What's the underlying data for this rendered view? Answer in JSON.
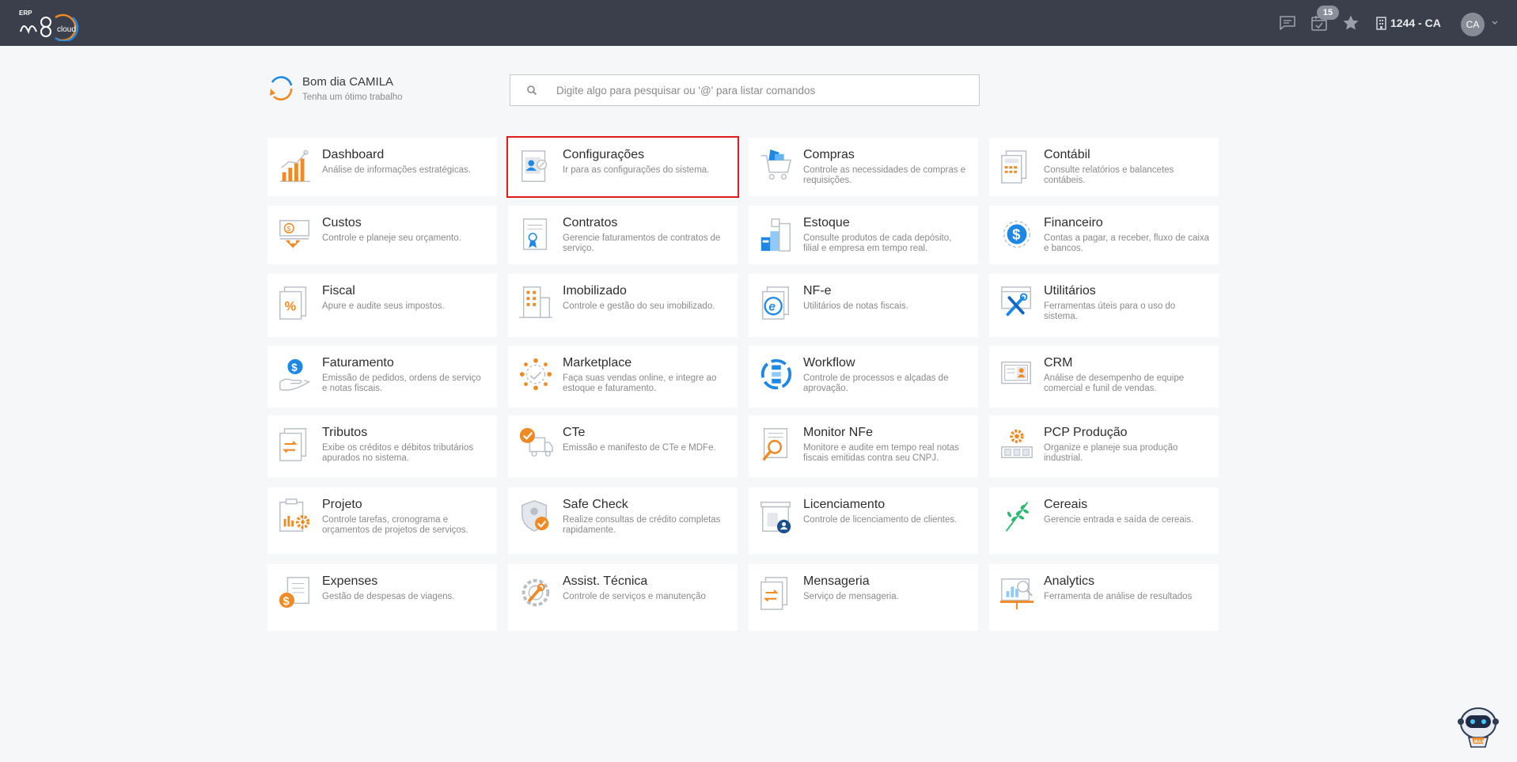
{
  "header": {
    "logo_erp": "ERP",
    "logo_m": "m8",
    "logo_cloud": "cloud",
    "notifications_badge": "15",
    "company": "1244 - CA",
    "avatar": "CA",
    "icons": [
      "chat-icon",
      "calendar-check-icon",
      "star-icon",
      "building-icon",
      "chevron-down-icon"
    ]
  },
  "greeting": {
    "title": "Bom dia CAMILA",
    "subtitle": "Tenha um ótimo trabalho"
  },
  "search": {
    "placeholder": "Digite algo para pesquisar ou '@' para listar comandos"
  },
  "modules": [
    {
      "title": "Dashboard",
      "desc": "Análise de informações estratégicas."
    },
    {
      "title": "Configurações",
      "desc": "Ir para as configurações do sistema.",
      "selected": true
    },
    {
      "title": "Compras",
      "desc": "Controle as necessidades de compras e requisições."
    },
    {
      "title": "Contábil",
      "desc": "Consulte relatórios e balancetes contábeis."
    },
    {
      "title": "Custos",
      "desc": "Controle e planeje seu orçamento."
    },
    {
      "title": "Contratos",
      "desc": "Gerencie faturamentos de contratos de serviço."
    },
    {
      "title": "Estoque",
      "desc": "Consulte produtos de cada depósito, filial e empresa em tempo real."
    },
    {
      "title": "Financeiro",
      "desc": "Contas a pagar, a receber, fluxo de caixa e bancos."
    },
    {
      "title": "Fiscal",
      "desc": "Apure e audite seus impostos."
    },
    {
      "title": "Imobilizado",
      "desc": "Controle e gestão do seu imobilizado."
    },
    {
      "title": "NF-e",
      "desc": "Utilitários de notas fiscais."
    },
    {
      "title": "Utilitários",
      "desc": "Ferramentas úteis para o uso do sistema."
    },
    {
      "title": "Faturamento",
      "desc": "Emissão de pedidos, ordens de serviço e notas fiscais."
    },
    {
      "title": "Marketplace",
      "desc": "Faça suas vendas online, e integre ao estoque e faturamento."
    },
    {
      "title": "Workflow",
      "desc": "Controle de processos e alçadas de aprovação."
    },
    {
      "title": "CRM",
      "desc": "Análise de desempenho de equipe comercial e funil de vendas."
    },
    {
      "title": "Tributos",
      "desc": "Exibe os créditos e débitos tributários apurados no sistema."
    },
    {
      "title": "CTe",
      "desc": "Emissão e manifesto de CTe e MDFe."
    },
    {
      "title": "Monitor NFe",
      "desc": "Monitore e audite em tempo real notas fiscais emitidas contra seu CNPJ."
    },
    {
      "title": "PCP Produção",
      "desc": "Organize e planeje sua produção industrial."
    },
    {
      "title": "Projeto",
      "desc": "Controle tarefas, cronograma e orçamentos de projetos de serviços."
    },
    {
      "title": "Safe Check",
      "desc": "Realize consultas de crédito completas rapidamente."
    },
    {
      "title": "Licenciamento",
      "desc": "Controle de licenciamento de clientes."
    },
    {
      "title": "Cereais",
      "desc": "Gerencie entrada e saída de cereais."
    },
    {
      "title": "Expenses",
      "desc": "Gestão de despesas de viagens."
    },
    {
      "title": "Assist. Técnica",
      "desc": "Controle de serviços e manutenção"
    },
    {
      "title": "Mensageria",
      "desc": "Serviço de mensageria."
    },
    {
      "title": "Analytics",
      "desc": "Ferramenta de análise de resultados"
    }
  ],
  "assistant": {
    "label": "MAX"
  },
  "colors": {
    "topbar": "#3b3f4c",
    "accent_orange": "#f08a24",
    "accent_blue": "#1e88e5",
    "selection": "#e01b1b"
  }
}
